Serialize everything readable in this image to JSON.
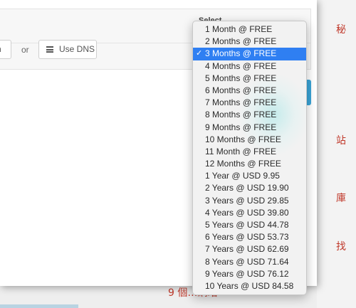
{
  "background": {
    "side_labels": [
      "秘",
      "站",
      "庫",
      "找"
    ],
    "footer_text": "9 個…網站"
  },
  "modal": {
    "label_behind": "Select",
    "left_button_partial": "n",
    "or_text": "or",
    "use_dns_button": "Use DNS",
    "icons": {
      "use_dns": "list-icon"
    }
  },
  "dropdown": {
    "selected_index": 2,
    "selected_mark": "✓",
    "options": [
      "1 Month @ FREE",
      "2 Months @ FREE",
      "3 Months @ FREE",
      "4 Months @ FREE",
      "5 Months @ FREE",
      "6 Months @ FREE",
      "7 Months @ FREE",
      "8 Months @ FREE",
      "9 Months @ FREE",
      "10 Months @ FREE",
      "11 Month @ FREE",
      "12 Months @ FREE",
      "1 Year @ USD 9.95",
      "2 Years @ USD 19.90",
      "3 Years @ USD 29.85",
      "4 Years @ USD 39.80",
      "5 Years @ USD 44.78",
      "6 Years @ USD 53.73",
      "7 Years @ USD 62.69",
      "8 Years @ USD 71.64",
      "9 Years @ USD 76.12",
      "10 Years @ USD 84.58"
    ]
  },
  "colors": {
    "selection": "#2f7ff2",
    "accent_red": "#c0392b",
    "button_blue": "#3aa5d8"
  }
}
